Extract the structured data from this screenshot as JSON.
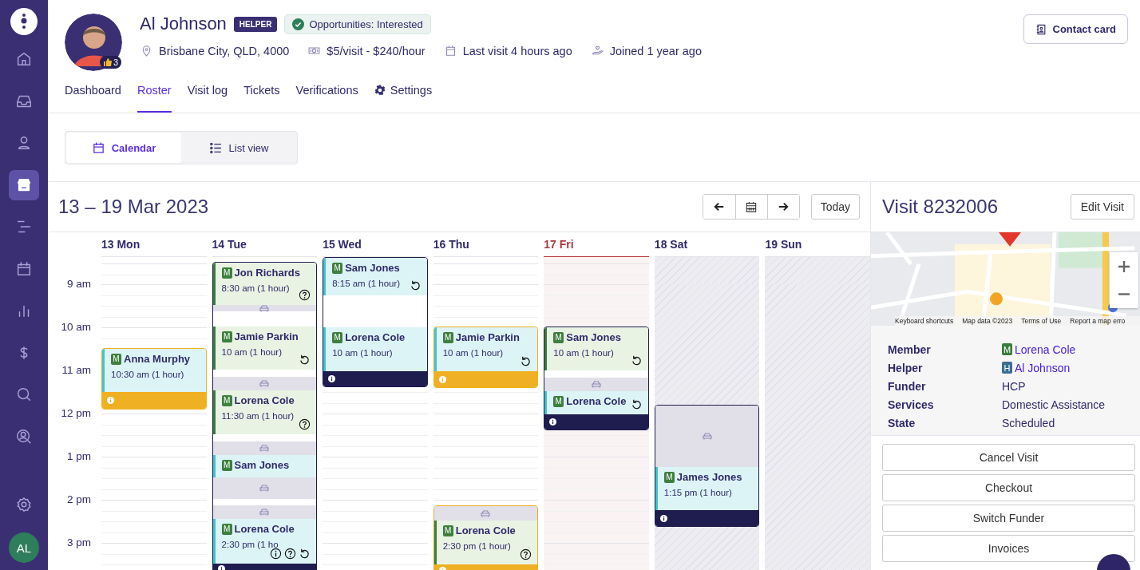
{
  "sidebar": {
    "items": [
      {
        "selected": false
      },
      {
        "selected": false
      },
      {
        "selected": false
      },
      {
        "selected": true
      },
      {
        "selected": false
      },
      {
        "selected": false
      },
      {
        "selected": false
      },
      {
        "selected": false
      },
      {
        "selected": false
      },
      {
        "selected": false
      }
    ],
    "user_initials": "AL"
  },
  "profile": {
    "name": "Al Johnson",
    "role": "HELPER",
    "status": "Opportunities: Interested",
    "rating": "3",
    "meta": [
      "Brisbane City, QLD, 4000",
      "$5/visit - $240/hour",
      "Last visit 4 hours ago",
      "Joined 1 year ago"
    ]
  },
  "contact_button": "Contact card",
  "tabs": [
    {
      "label": "Dashboard",
      "selected": false,
      "kind": "page"
    },
    {
      "label": "Roster",
      "selected": true,
      "kind": "page"
    },
    {
      "label": "Visit log",
      "selected": false,
      "kind": "page"
    },
    {
      "label": "Tickets",
      "selected": false,
      "kind": "page"
    },
    {
      "label": "Verifications",
      "selected": false,
      "kind": "page"
    },
    {
      "label": "Settings",
      "selected": false,
      "kind": "settings"
    }
  ],
  "view_toggle": [
    {
      "label": "Calendar",
      "selected": true
    },
    {
      "label": "List view",
      "selected": false
    }
  ],
  "calendar": {
    "range": "13 – 19 Mar 2023",
    "today_button": "Today",
    "time_labels": [
      "9 am",
      "10 am",
      "11 am",
      "12 pm",
      "1 pm",
      "2 pm",
      "3 pm"
    ],
    "days": [
      {
        "label": "13 Mon",
        "kind": "weekday",
        "blocks": [
          {
            "color": "#f0b023",
            "segments": [
              {
                "kind": "visit",
                "tag": "M",
                "name": "Anna Murphy",
                "time": "10:30 am (1 hour)",
                "color": "#41c4cc"
              },
              {
                "kind": "footer"
              }
            ]
          }
        ]
      },
      {
        "label": "14 Tue",
        "kind": "weekday",
        "blocks": [
          {
            "color": "#1f1c4f",
            "segments": [
              {
                "kind": "visit",
                "tag": "M",
                "name": "Jon Richards",
                "time": "8:30 am (1 hour)",
                "color": "#3a7d3c",
                "unconfirmed": true
              },
              {
                "kind": "travel"
              },
              {
                "kind": "visit",
                "tag": "M",
                "name": "Jamie Parkin",
                "time": "10 am (1 hour)",
                "color": "#3a7d3c",
                "recurring": true
              },
              {
                "kind": "travel"
              },
              {
                "kind": "visit",
                "tag": "M",
                "name": "Lorena Cole",
                "time": "11:30 am (1 hour)",
                "color": "#3a7d3c",
                "unconfirmed": true
              },
              {
                "kind": "travel"
              },
              {
                "kind": "visit",
                "tag": "M",
                "name": "Sam Jones",
                "color": "#41c4cc"
              },
              {
                "kind": "travel"
              },
              {
                "kind": "travel"
              },
              {
                "kind": "visit",
                "tag": "M",
                "name": "Lorena Cole",
                "time": "2:30 pm (1 ho",
                "color": "#41c4cc",
                "note": true,
                "unconfirmed": true,
                "recurring": true
              },
              {
                "kind": "footer"
              }
            ]
          }
        ]
      },
      {
        "label": "15 Wed",
        "kind": "weekday",
        "blocks": [
          {
            "color": "#1f1c4f",
            "segments": [
              {
                "kind": "visit",
                "tag": "M",
                "name": "Sam Jones",
                "time": "8:15 am (1 hour)",
                "color": "#41c4cc",
                "recurring": true
              },
              {
                "kind": "visit",
                "tag": "M",
                "name": "Lorena Cole",
                "time": "10 am (1 hour)",
                "color": "#41c4cc"
              },
              {
                "kind": "footer"
              }
            ]
          }
        ]
      },
      {
        "label": "16 Thu",
        "kind": "weekday",
        "blocks": [
          {
            "color": "#f0b023",
            "segments": [
              {
                "kind": "visit",
                "tag": "M",
                "name": "Jamie Parkin",
                "time": "10 am (1 hour)",
                "color": "#41c4cc",
                "recurring": true
              },
              {
                "kind": "footer"
              }
            ]
          },
          {
            "color": "#f0b023",
            "segments": [
              {
                "kind": "travel"
              },
              {
                "kind": "visit",
                "tag": "M",
                "name": "Lorena Cole",
                "time": "2:30 pm (1 hour)",
                "color": "#3a7d3c",
                "unconfirmed": true
              },
              {
                "kind": "footer"
              }
            ]
          }
        ]
      },
      {
        "label": "17 Fri",
        "kind": "today",
        "blocks": [
          {
            "color": "#1f1c4f",
            "segments": [
              {
                "kind": "visit",
                "tag": "M",
                "name": "Sam Jones",
                "time": "10 am (1 hour)",
                "color": "#3a7d3c",
                "recurring": true
              },
              {
                "kind": "travel"
              },
              {
                "kind": "visit",
                "tag": "M",
                "name": "Lorena Cole",
                "color": "#41c4cc",
                "recurring": true
              },
              {
                "kind": "footer"
              }
            ]
          }
        ]
      },
      {
        "label": "18 Sat",
        "kind": "weekend",
        "blocks": [
          {
            "color": "#1f1c4f",
            "segments": [
              {
                "kind": "travel"
              },
              {
                "kind": "visit",
                "tag": "M",
                "name": "James Jones",
                "time": "1:15 pm (1 hour)",
                "color": "#41c4cc"
              },
              {
                "kind": "footer"
              }
            ]
          }
        ]
      },
      {
        "label": "19 Sun",
        "kind": "weekend"
      }
    ]
  },
  "visit_panel": {
    "title": "Visit 8232006",
    "edit_button": "Edit Visit",
    "map_attribution": [
      "Keyboard shortcuts",
      "Map data ©2023",
      "Terms of Use",
      "Report a map erro"
    ],
    "details": [
      {
        "label": "Member",
        "tag": "M",
        "color": "#3a7d3c",
        "value": "Lorena Cole",
        "kind": "link"
      },
      {
        "label": "Helper",
        "tag": "H",
        "color": "#3d6e91",
        "value": "Al Johnson",
        "kind": "link"
      },
      {
        "label": "Funder",
        "value": "HCP",
        "kind": "text"
      },
      {
        "label": "Services",
        "value": "Domestic Assistance",
        "kind": "text"
      },
      {
        "label": "State",
        "value": "Scheduled",
        "kind": "text"
      }
    ],
    "actions": [
      "Cancel Visit",
      "Checkout",
      "Switch Funder",
      "Invoices"
    ]
  }
}
